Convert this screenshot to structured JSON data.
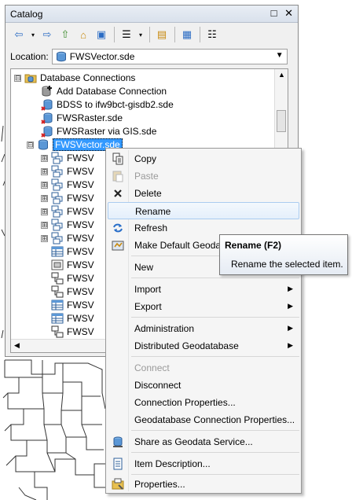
{
  "catalog": {
    "title": "Catalog",
    "window_buttons": {
      "restore": "□",
      "close": "✕"
    },
    "toolbar": {
      "buttons": [
        {
          "name": "back-icon",
          "glyph": "⇦"
        },
        {
          "name": "back-dropdown-icon",
          "glyph": "▾"
        },
        {
          "name": "forward-icon",
          "glyph": "⇨"
        },
        {
          "name": "up-one-level-icon",
          "glyph": "⇧"
        },
        {
          "name": "home-icon",
          "glyph": "⌂"
        },
        {
          "name": "toggle-contents-icon",
          "glyph": "▣"
        },
        {
          "name": "view-list-icon",
          "glyph": "☰"
        },
        {
          "name": "view-dropdown-icon",
          "glyph": "▾"
        },
        {
          "name": "connect-folder-icon",
          "glyph": "▤"
        },
        {
          "name": "disconnect-folder-icon",
          "glyph": "▦"
        },
        {
          "name": "options-icon",
          "glyph": "☷"
        }
      ]
    },
    "location": {
      "label": "Location:",
      "value": "FWSVector.sde"
    }
  },
  "tree": {
    "items": [
      {
        "label": "Database Connections",
        "icon": "database-connections-icon",
        "expander": "⊟"
      },
      {
        "label": "Add Database Connection",
        "icon": "add-connection-icon"
      },
      {
        "label": "BDSS to ifw9bct-gisdb2.sde",
        "icon": "sde-connection-error-icon"
      },
      {
        "label": "FWSRaster.sde",
        "icon": "sde-connection-error-icon"
      },
      {
        "label": "FWSRaster via GIS.sde",
        "icon": "sde-connection-error-icon"
      },
      {
        "label": "FWSVector.sde",
        "icon": "sde-connection-icon",
        "expander": "⊟",
        "selected": true
      },
      {
        "label": "FWSV",
        "icon": "feature-dataset-icon",
        "expander": "⊞"
      },
      {
        "label": "FWSV",
        "icon": "feature-dataset-icon",
        "expander": "⊞"
      },
      {
        "label": "FWSV",
        "icon": "feature-dataset-icon",
        "expander": "⊞"
      },
      {
        "label": "FWSV",
        "icon": "feature-dataset-icon",
        "expander": "⊞"
      },
      {
        "label": "FWSV",
        "icon": "feature-dataset-icon",
        "expander": "⊞"
      },
      {
        "label": "FWSV",
        "icon": "feature-dataset-icon",
        "expander": "⊞"
      },
      {
        "label": "FWSV",
        "icon": "feature-dataset-icon",
        "expander": "⊞"
      },
      {
        "label": "FWSV",
        "icon": "table-icon"
      },
      {
        "label": "FWSV",
        "icon": "raster-icon"
      },
      {
        "label": "FWSV",
        "icon": "relationship-class-icon"
      },
      {
        "label": "FWSV",
        "icon": "relationship-class-icon"
      },
      {
        "label": "FWSV",
        "icon": "table-icon"
      },
      {
        "label": "FWSV",
        "icon": "table-icon"
      },
      {
        "label": "FWSV",
        "icon": "relationship-class-icon"
      }
    ]
  },
  "context_menu": {
    "items": [
      {
        "label": "Copy",
        "icon": "copy-icon"
      },
      {
        "label": "Paste",
        "icon": "paste-icon",
        "disabled": true
      },
      {
        "label": "Delete",
        "icon": "delete-icon"
      },
      {
        "label": "Rename",
        "highlighted": true
      },
      {
        "label": "Refresh",
        "icon": "refresh-icon"
      },
      {
        "label": "Make Default Geoda",
        "icon": "make-default-icon"
      },
      {
        "label": "New",
        "submenu": true
      },
      {
        "label": "Import",
        "submenu": true
      },
      {
        "label": "Export",
        "submenu": true
      },
      {
        "label": "Administration",
        "submenu": true
      },
      {
        "label": "Distributed Geodatabase",
        "submenu": true
      },
      {
        "label": "Connect",
        "disabled": true
      },
      {
        "label": "Disconnect"
      },
      {
        "label": "Connection Properties..."
      },
      {
        "label": "Geodatabase Connection Properties..."
      },
      {
        "label": "Share as Geodata Service...",
        "icon": "share-service-icon"
      },
      {
        "label": "Item Description...",
        "icon": "item-description-icon"
      },
      {
        "label": "Properties...",
        "icon": "properties-icon"
      }
    ]
  },
  "tooltip": {
    "title": "Rename (F2)",
    "description": "Rename the selected item."
  },
  "colors": {
    "selection": "#3399ff",
    "menu_highlight_border": "#aaccf0",
    "error_red": "#d42020"
  }
}
